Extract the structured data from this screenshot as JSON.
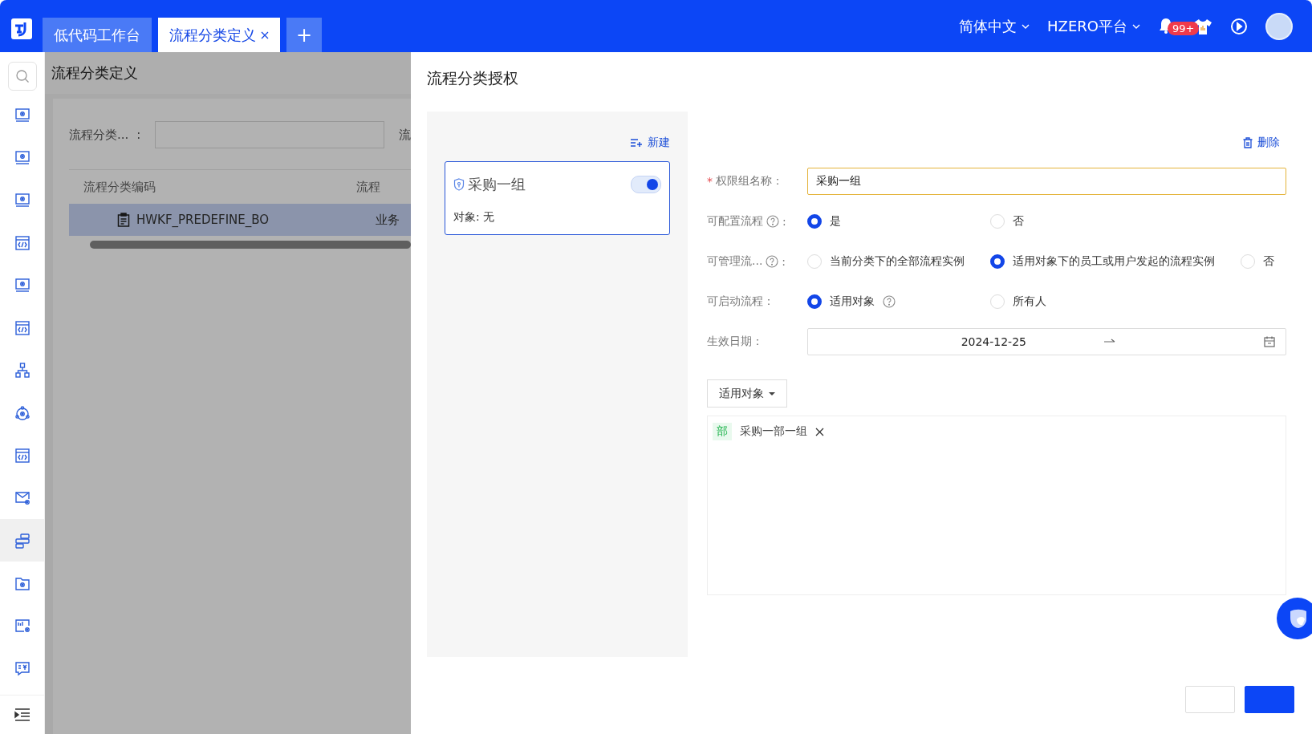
{
  "header": {
    "tabs": [
      {
        "label": "低代码工作台",
        "selected": false
      },
      {
        "label": "流程分类定义",
        "selected": true,
        "closable": true
      }
    ],
    "add_tab": "+",
    "language": "简体中文",
    "platform": "HZERO平台",
    "notification_badge": "99+"
  },
  "sidebar": {
    "items": [
      {
        "selected": false
      },
      {
        "selected": false
      },
      {
        "selected": false
      },
      {
        "selected": false
      },
      {
        "selected": false
      },
      {
        "selected": false
      },
      {
        "selected": false
      },
      {
        "selected": false
      },
      {
        "selected": false
      },
      {
        "selected": false
      },
      {
        "selected": true
      },
      {
        "selected": false
      },
      {
        "selected": false
      },
      {
        "selected": false
      }
    ]
  },
  "page": {
    "title": "流程分类定义",
    "filters": [
      {
        "label": "流程分类...",
        "suffix": ":"
      },
      {
        "label": "流"
      }
    ],
    "table": {
      "columns": [
        "流程分类编码",
        "流程"
      ],
      "rows": [
        {
          "cells": [
            "HWKF_PREDEFINE_BO",
            "业务"
          ],
          "selected": true
        }
      ]
    }
  },
  "drawer": {
    "title": "流程分类授权",
    "new_button": "新建",
    "delete_button": "删除",
    "groups": [
      {
        "name": "采购一组",
        "enabled": true,
        "selected": true,
        "objects": "对象: 无"
      }
    ],
    "fields": [
      {
        "kind": "text",
        "label": "权限组名称：",
        "required_mark": "*",
        "value": "采购一组"
      },
      {
        "kind": "radio",
        "label": "可配置流程",
        "help": true,
        "suffix": ":",
        "options": [
          {
            "label": "是",
            "selected": true
          },
          {
            "label": "否",
            "selected": false
          }
        ]
      },
      {
        "kind": "radio",
        "label": "可管理流...",
        "help": true,
        "suffix": ":",
        "options": [
          {
            "label": "当前分类下的全部流程实例",
            "selected": false
          },
          {
            "label": "适用对象下的员工或用户发起的流程实例",
            "selected": true
          },
          {
            "label": "否",
            "selected": false
          }
        ]
      },
      {
        "kind": "radio",
        "label": "可启动流程：",
        "options": [
          {
            "label": "适用对象",
            "selected": true,
            "help": true
          },
          {
            "label": "所有人",
            "selected": false
          }
        ]
      },
      {
        "kind": "daterange",
        "label": "生效日期：",
        "start": "2024-12-25"
      }
    ],
    "target_button": "适用对象",
    "targets": [
      {
        "type_tag": "部",
        "name": "采购一部一组"
      }
    ]
  }
}
